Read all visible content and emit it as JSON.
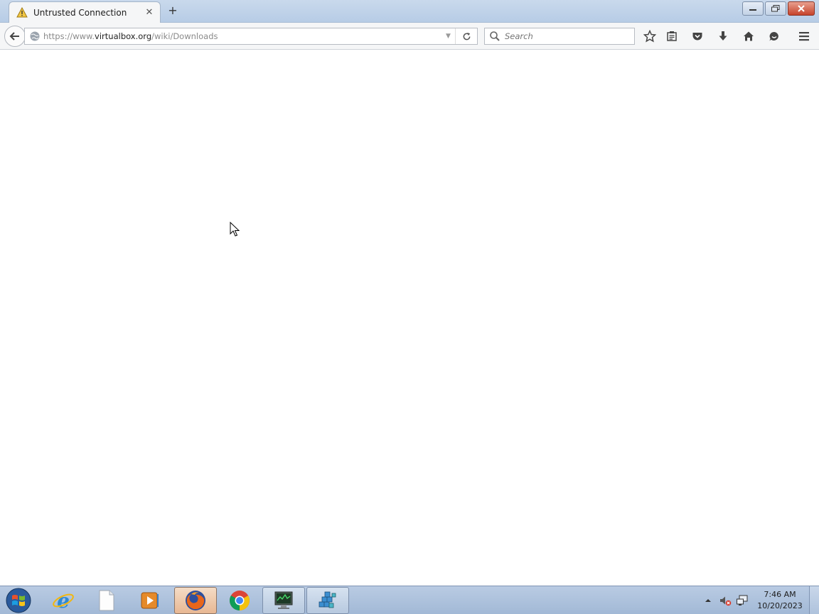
{
  "browser": {
    "tab": {
      "title": "Untrusted Connection",
      "icon": "warning-icon"
    },
    "url": {
      "prefix": "https://www.",
      "host": "virtualbox.org",
      "path": "/wiki/Downloads"
    },
    "search": {
      "placeholder": "Search"
    },
    "toolbar_icons": [
      "bookmark-star-icon",
      "reading-list-icon",
      "pocket-icon",
      "download-icon",
      "home-icon",
      "hello-icon",
      "menu-icon"
    ]
  },
  "taskbar": {
    "apps": [
      "internet-explorer",
      "file",
      "media-player",
      "firefox",
      "chrome",
      "computer-monitor",
      "registry-tool"
    ],
    "active_app": "firefox",
    "clock": {
      "time": "7:46 AM",
      "date": "10/20/2023"
    }
  },
  "colors": {
    "titlebar": "#c9d9ec",
    "close": "#c6432b",
    "taskbar": "#a2b9d6"
  }
}
